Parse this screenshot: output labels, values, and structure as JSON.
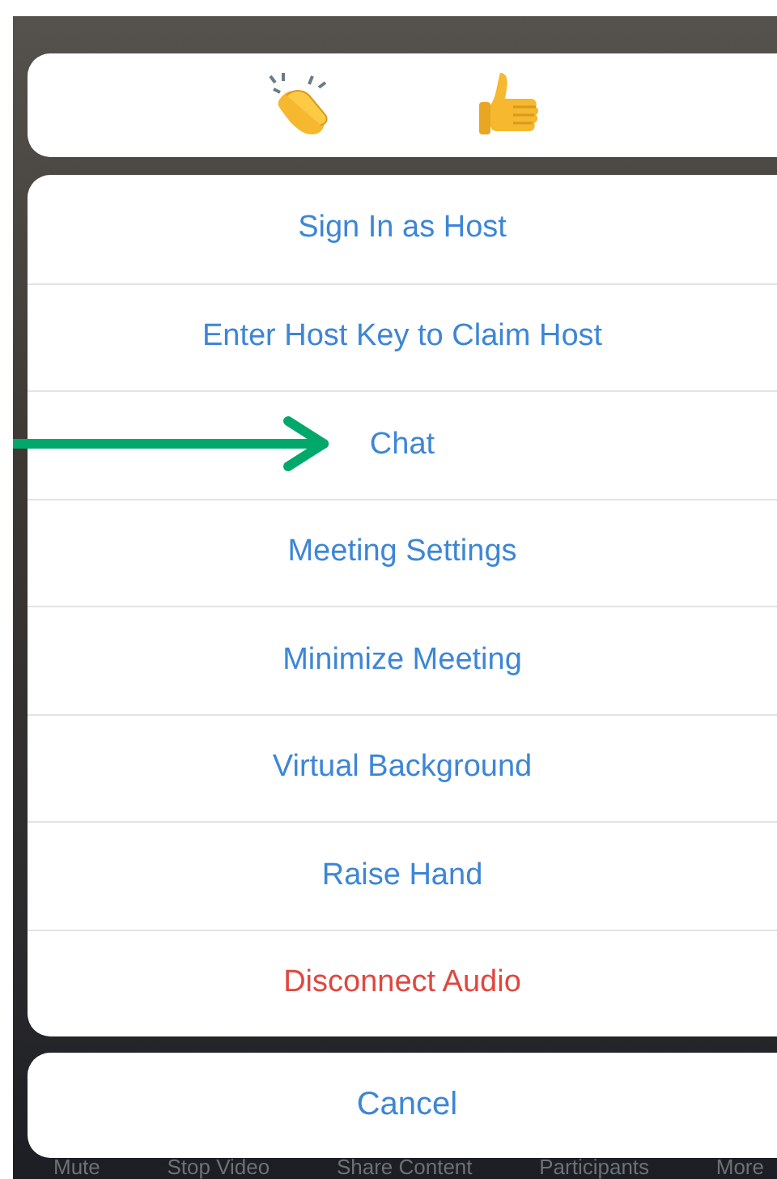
{
  "reactions": [
    {
      "kind": "clap"
    },
    {
      "kind": "thumbs_up"
    }
  ],
  "menu": [
    {
      "label": "Sign In as Host",
      "kind": "default",
      "pointed_at": false
    },
    {
      "label": "Enter Host Key to Claim Host",
      "kind": "default",
      "pointed_at": false
    },
    {
      "label": "Chat",
      "kind": "default",
      "pointed_at": true
    },
    {
      "label": "Meeting Settings",
      "kind": "default",
      "pointed_at": false
    },
    {
      "label": "Minimize Meeting",
      "kind": "default",
      "pointed_at": false
    },
    {
      "label": "Virtual Background",
      "kind": "default",
      "pointed_at": false
    },
    {
      "label": "Raise Hand",
      "kind": "default",
      "pointed_at": false
    },
    {
      "label": "Disconnect Audio",
      "kind": "destructive",
      "pointed_at": false
    }
  ],
  "cancel": "Cancel",
  "toolbar": [
    "Mute",
    "Stop Video",
    "Share Content",
    "Participants",
    "More"
  ]
}
